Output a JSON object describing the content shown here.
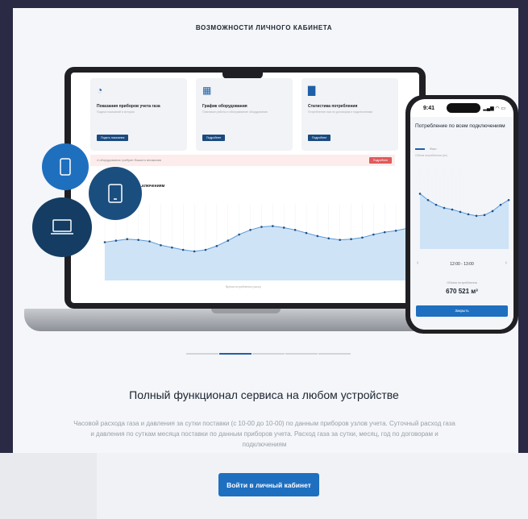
{
  "section": {
    "heading": "ВОЗМОЖНОСТИ ЛИЧНОГО КАБИНЕТА"
  },
  "laptop": {
    "features": [
      {
        "icon": "gauge-icon",
        "title": "Показания приборов учета газа",
        "desc": "Подача показаний и история",
        "button": "Подать показания"
      },
      {
        "icon": "calendar-icon",
        "title": "График оборудования",
        "desc": "Плановые работы и обслуживание оборудования",
        "button": "Подробнее"
      },
      {
        "icon": "bar-chart-icon",
        "title": "Статистика потребления",
        "desc": "Потребление газа по договорам и подключениям",
        "button": "Подробнее"
      }
    ],
    "alert": {
      "text": "4 оборудования требуют Вашего внимания",
      "button": "Подробнее"
    },
    "chart_title": "...ключениям",
    "x_label": "Время потребления (часы)"
  },
  "phone": {
    "time": "9:41",
    "status": "▂▄▆ ◠ ▭",
    "title": "Потребление по всем подключениям",
    "legend": "Факт",
    "subtitle": "Объем потребления (м³)",
    "range": "12:00 - 13:00",
    "volume_label": "Объем потребления",
    "volume": "670 521 м³",
    "button": "Закрыть"
  },
  "main": {
    "title": "Полный функционал сервиса на любом устройстве",
    "description": "Часовой расхода газа и давления за сутки поставки (с 10-00 до 10-00) по данным приборов узлов учета. Суточный расход газа и давления по суткам месяца поставки по данным приборов учета. Расход газа за сутки, месяц, год по договорам и подключениям",
    "cta": "Войти в личный кабинет"
  },
  "chart_data": [
    {
      "type": "area",
      "values": [
        50,
        52,
        54,
        53,
        51,
        46,
        43,
        40,
        38,
        40,
        45,
        52,
        60,
        66,
        70,
        71,
        69,
        66,
        62,
        58,
        55,
        53,
        54,
        56,
        60,
        63,
        65,
        68
      ]
    },
    {
      "type": "area",
      "values": [
        70,
        62,
        56,
        52,
        50,
        47,
        44,
        42,
        43,
        48,
        56,
        62
      ]
    }
  ],
  "colors": {
    "accent": "#1e6fc0",
    "dark": "#153d63",
    "text": "#1b2430"
  }
}
